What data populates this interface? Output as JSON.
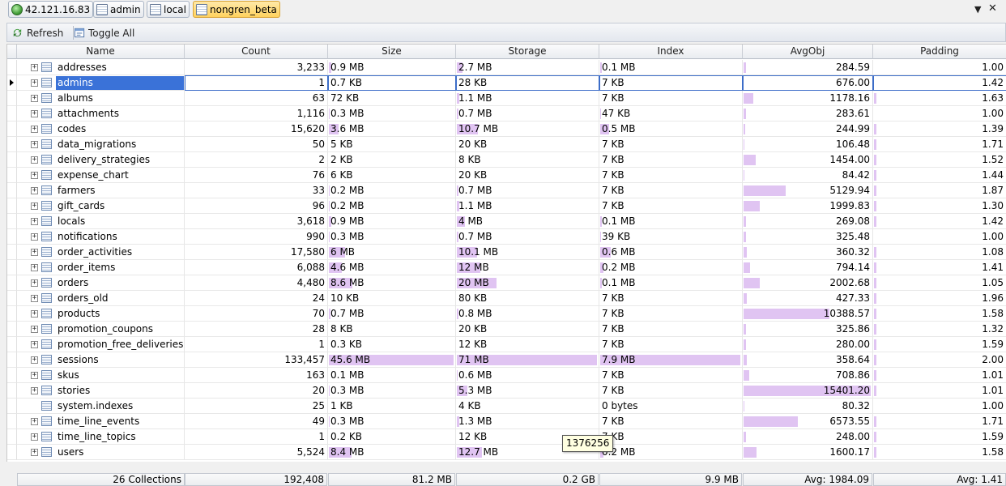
{
  "breadcrumbs": [
    {
      "label": "42.121.16.83",
      "icon": "server-globe-icon",
      "active": false
    },
    {
      "label": "admin",
      "icon": "database-icon",
      "active": false
    },
    {
      "label": "local",
      "icon": "database-icon",
      "active": false
    },
    {
      "label": "nongren_beta",
      "icon": "database-icon",
      "active": true
    }
  ],
  "window": {
    "dropdown_glyph": "▼",
    "close_glyph": "✕"
  },
  "toolbar": {
    "refresh_label": "Refresh",
    "toggle_all_label": "Toggle All"
  },
  "columns": [
    "Name",
    "Count",
    "Size",
    "Storage",
    "Index",
    "AvgObj",
    "Padding"
  ],
  "colors": {
    "selection": "#3a72d8",
    "bar": "#e0c4f2",
    "tooltip_bg": "#ffffe1"
  },
  "rows": [
    {
      "name": "addresses",
      "count": "3,233",
      "size": "0.9 MB",
      "storage": "2.7 MB",
      "index": "0.1 MB",
      "avgobj": "284.59",
      "padding": "1.00"
    },
    {
      "name": "admins",
      "count": "1",
      "size": "0.7 KB",
      "storage": "28 KB",
      "index": "7 KB",
      "avgobj": "676.00",
      "padding": "1.42",
      "selected": true
    },
    {
      "name": "albums",
      "count": "63",
      "size": "72 KB",
      "storage": "1.1 MB",
      "index": "7 KB",
      "avgobj": "1178.16",
      "padding": "1.63"
    },
    {
      "name": "attachments",
      "count": "1,116",
      "size": "0.3 MB",
      "storage": "0.7 MB",
      "index": "47 KB",
      "avgobj": "283.61",
      "padding": "1.00"
    },
    {
      "name": "codes",
      "count": "15,620",
      "size": "3.6 MB",
      "storage": "10.7 MB",
      "index": "0.5 MB",
      "avgobj": "244.99",
      "padding": "1.39"
    },
    {
      "name": "data_migrations",
      "count": "50",
      "size": "5 KB",
      "storage": "20 KB",
      "index": "7 KB",
      "avgobj": "106.48",
      "padding": "1.71"
    },
    {
      "name": "delivery_strategies",
      "count": "2",
      "size": "2 KB",
      "storage": "8 KB",
      "index": "7 KB",
      "avgobj": "1454.00",
      "padding": "1.52"
    },
    {
      "name": "expense_chart",
      "count": "76",
      "size": "6 KB",
      "storage": "20 KB",
      "index": "7 KB",
      "avgobj": "84.42",
      "padding": "1.44"
    },
    {
      "name": "farmers",
      "count": "33",
      "size": "0.2 MB",
      "storage": "0.7 MB",
      "index": "7 KB",
      "avgobj": "5129.94",
      "padding": "1.87"
    },
    {
      "name": "gift_cards",
      "count": "96",
      "size": "0.2 MB",
      "storage": "1.1 MB",
      "index": "7 KB",
      "avgobj": "1999.83",
      "padding": "1.30"
    },
    {
      "name": "locals",
      "count": "3,618",
      "size": "0.9 MB",
      "storage": "4 MB",
      "index": "0.1 MB",
      "avgobj": "269.08",
      "padding": "1.42"
    },
    {
      "name": "notifications",
      "count": "990",
      "size": "0.3 MB",
      "storage": "0.7 MB",
      "index": "39 KB",
      "avgobj": "325.48",
      "padding": "1.00"
    },
    {
      "name": "order_activities",
      "count": "17,580",
      "size": "6 MB",
      "storage": "10.1 MB",
      "index": "0.6 MB",
      "avgobj": "360.32",
      "padding": "1.08"
    },
    {
      "name": "order_items",
      "count": "6,088",
      "size": "4.6 MB",
      "storage": "12 MB",
      "index": "0.2 MB",
      "avgobj": "794.14",
      "padding": "1.41"
    },
    {
      "name": "orders",
      "count": "4,480",
      "size": "8.6 MB",
      "storage": "20 MB",
      "index": "0.1 MB",
      "avgobj": "2002.68",
      "padding": "1.05"
    },
    {
      "name": "orders_old",
      "count": "24",
      "size": "10 KB",
      "storage": "80 KB",
      "index": "7 KB",
      "avgobj": "427.33",
      "padding": "1.96"
    },
    {
      "name": "products",
      "count": "70",
      "size": "0.7 MB",
      "storage": "0.8 MB",
      "index": "7 KB",
      "avgobj": "10388.57",
      "padding": "1.58"
    },
    {
      "name": "promotion_coupons",
      "count": "28",
      "size": "8 KB",
      "storage": "20 KB",
      "index": "7 KB",
      "avgobj": "325.86",
      "padding": "1.32"
    },
    {
      "name": "promotion_free_deliveries",
      "count": "1",
      "size": "0.3 KB",
      "storage": "12 KB",
      "index": "7 KB",
      "avgobj": "280.00",
      "padding": "1.59"
    },
    {
      "name": "sessions",
      "count": "133,457",
      "size": "45.6 MB",
      "storage": "71 MB",
      "index": "7.9 MB",
      "avgobj": "358.64",
      "padding": "2.00"
    },
    {
      "name": "skus",
      "count": "163",
      "size": "0.1 MB",
      "storage": "0.6 MB",
      "index": "7 KB",
      "avgobj": "708.86",
      "padding": "1.01"
    },
    {
      "name": "stories",
      "count": "20",
      "size": "0.3 MB",
      "storage": "5.3 MB",
      "index": "7 KB",
      "avgobj": "15401.20",
      "padding": "1.01"
    },
    {
      "name": "system.indexes",
      "count": "25",
      "size": "1 KB",
      "storage": "4 KB",
      "index": "0 bytes",
      "avgobj": "80.32",
      "padding": "1.00",
      "no_expander": true
    },
    {
      "name": "time_line_events",
      "count": "49",
      "size": "0.3 MB",
      "storage": "1.3 MB",
      "index": "7 KB",
      "avgobj": "6573.55",
      "padding": "1.71"
    },
    {
      "name": "time_line_topics",
      "count": "1",
      "size": "0.2 KB",
      "storage": "12 KB",
      "index": "7 KB",
      "avgobj": "248.00",
      "padding": "1.59"
    },
    {
      "name": "users",
      "count": "5,524",
      "size": "8.4 MB",
      "storage": "12.7 MB",
      "index": "0.2 MB",
      "avgobj": "1600.17",
      "padding": "1.58"
    }
  ],
  "footer": {
    "collections": "26 Collections",
    "count": "192,408",
    "size": "81.2 MB",
    "storage": "0.2 GB",
    "index": "9.9 MB",
    "avgobj": "Avg: 1984.09",
    "padding": "Avg: 1.41"
  },
  "tooltip": "1376256"
}
